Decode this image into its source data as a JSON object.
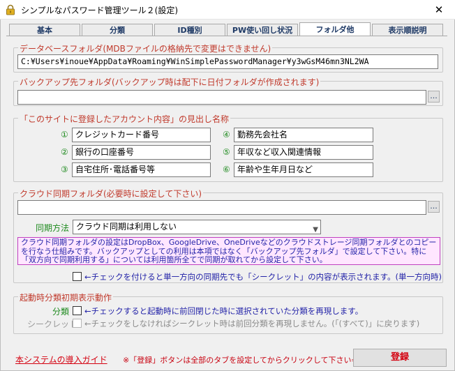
{
  "window": {
    "title": "シンプルなパスワード管理ツール２(設定)",
    "close_glyph": "✕"
  },
  "tabs": [
    {
      "label": "基本"
    },
    {
      "label": "分類"
    },
    {
      "label": "ID種別"
    },
    {
      "label": "PW使い回し状況"
    },
    {
      "label": "フォルダ他"
    },
    {
      "label": "表示順説明"
    }
  ],
  "db_folder": {
    "legend": "データベースフォルダ(MDBファイルの格納先で変更はできません)",
    "path": "C:¥Users¥inoue¥AppData¥Roaming¥WinSimplePasswordManager¥y3wGsM46mn3NL2WA"
  },
  "backup_folder": {
    "legend": "バックアップ先フォルダ(バックアップ時は配下に日付フォルダが作成されます)",
    "value": "",
    "browse_label": "..."
  },
  "headings": {
    "legend": "「このサイトに登録したアカウント内容」の見出し名称",
    "items": [
      {
        "num": "①",
        "value": "クレジットカード番号"
      },
      {
        "num": "②",
        "value": "銀行の口座番号"
      },
      {
        "num": "③",
        "value": "自宅住所･電話番号等"
      },
      {
        "num": "④",
        "value": "勤務先会社名"
      },
      {
        "num": "⑤",
        "value": "年収など収入関連情報"
      },
      {
        "num": "⑥",
        "value": "年齢や生年月日など"
      }
    ]
  },
  "cloud": {
    "legend": "クラウド同期フォルダ(必要時に設定して下さい)",
    "value": "",
    "browse_label": "...",
    "method_label": "同期方法",
    "method_value": "クラウド同期は利用しない",
    "info_text": "クラウド同期フォルダの設定はDropBox、GoogleDrive、OneDriveなどのクラウドストレージ同期フォルダとのコピーを行なう仕組みです。バックアップとしての利用は本項ではなく「バックアップ先フォルダ」で設定して下さい。特に「双方向で同期利用する」については利用箇所全てで同期が取れてから設定して下さい。",
    "oneway_note": "←チェックを付けると単一方向の同期先でも「シークレット」の内容が表示されます。(単一方向時)"
  },
  "startup": {
    "legend": "起動時分類初期表示動作",
    "category_label": "分類",
    "category_note": "←チェックすると起動時に前回閉じた時に選択されていた分類を再現します。",
    "secret_label": "シークレット",
    "secret_note": "←チェックをしなければシークレット時は前回分類を再現しません。(「(すべて)」に戻ります)"
  },
  "footer": {
    "guide_link": "本システムの導入ガイド",
    "note": "※「登録」ボタンは全部のタブを設定してからクリックして下さい⇒",
    "register_label": "登録"
  },
  "colors": {
    "legend_red": "#c0392b",
    "label_green": "#1e8a1e",
    "note_blue": "#2323a8",
    "info_bg": "#ffe6ff",
    "register_red": "#d4000f"
  }
}
